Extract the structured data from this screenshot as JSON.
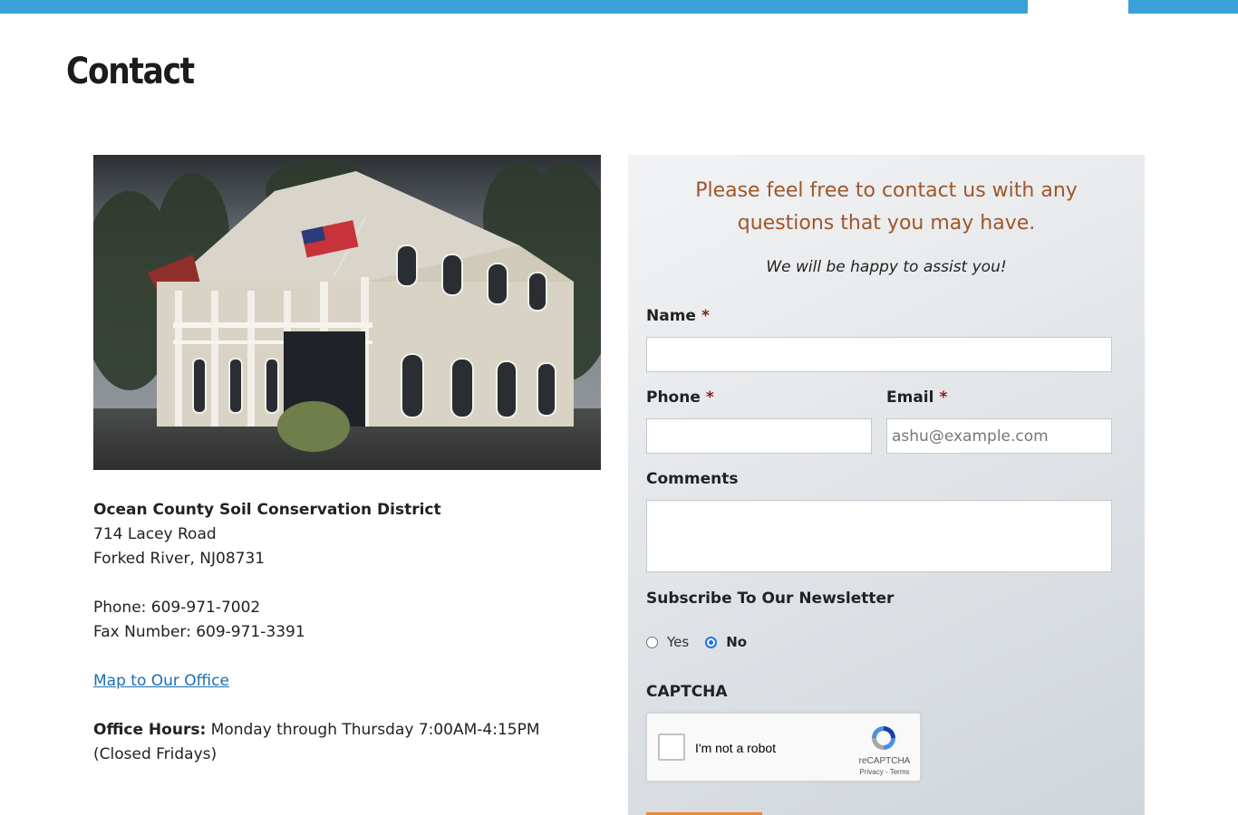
{
  "page": {
    "title": "Contact"
  },
  "photo": {
    "alt": "Ocean County Soil Conservation District office building"
  },
  "office": {
    "name": "Ocean County Soil Conservation District",
    "street": "714 Lacey Road",
    "city_line": "Forked River, NJ08731",
    "phone_line": "Phone: 609-971-7002",
    "fax_line": "Fax Number: 609-971-3391",
    "map_link": "Map to Our Office",
    "hours_label": "Office Hours:",
    "hours_value": " Monday through Thursday 7:00AM-4:15PM (Closed Fridays)"
  },
  "form": {
    "heading": "Please feel free to contact us with any questions that you may have.",
    "subheading": "We will be happy to assist you!",
    "required_marker": "*",
    "name_label": "Name",
    "name_value": "",
    "phone_label": "Phone",
    "phone_value": "",
    "email_label": "Email",
    "email_placeholder": "ashu@example.com",
    "comments_label": "Comments",
    "comments_value": "",
    "newsletter_label": "Subscribe To Our Newsletter",
    "newsletter_options": [
      "Yes",
      "No"
    ],
    "newsletter_selected": "No",
    "captcha_label": "CAPTCHA",
    "recaptcha": {
      "checkbox_text": "I'm not a robot",
      "brand": "reCAPTCHA",
      "terms": "Privacy - Terms"
    }
  },
  "colors": {
    "top_bar": "#3aa0d6",
    "heading_accent": "#a0562a",
    "link": "#1a6fb5",
    "required": "#8a1c1c",
    "radio_selected": "#1a73e8",
    "submit_accent": "#ee8a2c"
  }
}
